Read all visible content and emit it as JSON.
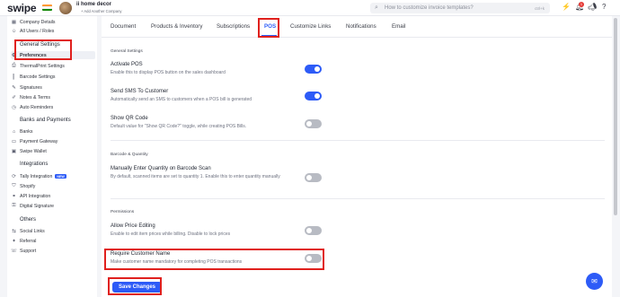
{
  "app": {
    "logo_text": "swipe",
    "company_name": "ii home decor",
    "add_company": "+ Add Another Company",
    "search_placeholder": "How to customize invoice templates?",
    "search_shortcut": "ctrl+k",
    "notification_count": "1",
    "flag_colors": [
      "#ff9933",
      "#ffffff",
      "#138808"
    ]
  },
  "sidebar": {
    "top_items": [
      {
        "label": "Company Details",
        "icon": "building-icon"
      },
      {
        "label": "All Users / Roles",
        "icon": "users-icon"
      }
    ],
    "groups": [
      {
        "heading": "General Settings",
        "items": [
          {
            "label": "Preferences",
            "icon": "gear-icon",
            "active": true
          },
          {
            "label": "ThermalPrint Settings",
            "icon": "printer-icon"
          },
          {
            "label": "Barcode Settings",
            "icon": "barcode-icon"
          },
          {
            "label": "Signatures",
            "icon": "signature-icon"
          },
          {
            "label": "Notes & Terms",
            "icon": "notes-icon"
          },
          {
            "label": "Auto Reminders",
            "icon": "clock-icon"
          }
        ]
      },
      {
        "heading": "Banks and Payments",
        "items": [
          {
            "label": "Banks",
            "icon": "bank-icon"
          },
          {
            "label": "Payment Gateway",
            "icon": "card-icon"
          },
          {
            "label": "Swipe Wallet",
            "icon": "wallet-icon"
          }
        ]
      },
      {
        "heading": "Integrations",
        "items": [
          {
            "label": "Tally Integration",
            "icon": "sync-icon",
            "tag": "NEW"
          },
          {
            "label": "Shopify",
            "icon": "shopify-icon"
          },
          {
            "label": "API Integration",
            "icon": "api-icon"
          },
          {
            "label": "Digital Signature",
            "icon": "key-icon"
          }
        ]
      },
      {
        "heading": "Others",
        "items": [
          {
            "label": "Social Links",
            "icon": "share-icon"
          },
          {
            "label": "Referral",
            "icon": "gift-icon"
          },
          {
            "label": "Support",
            "icon": "support-icon"
          }
        ]
      }
    ]
  },
  "tabs": [
    {
      "label": "Document"
    },
    {
      "label": "Products & Inventory"
    },
    {
      "label": "Subscriptions"
    },
    {
      "label": "POS",
      "active": true
    },
    {
      "label": "Customize Links"
    },
    {
      "label": "Notifications"
    },
    {
      "label": "Email"
    }
  ],
  "sections": {
    "general": "General Settings",
    "barcode": "Barcode & Quantity",
    "permissions": "Permissions"
  },
  "settings": [
    {
      "title": "Activate POS",
      "desc": "Enable this to display POS button on the sales dashboard",
      "on": true
    },
    {
      "title": "Send SMS To Customer",
      "desc": "Automatically send an SMS to customers when a POS bill is generated",
      "on": true
    },
    {
      "title": "Show QR Code",
      "desc": "Default value for \"Show QR Code?\" toggle, while creating POS Bills.",
      "on": false
    },
    {
      "title": "Manually Enter Quantity on Barcode Scan",
      "desc": "By default, scanned items are set to quantity 1. Enable this to enter quantity manually",
      "on": false
    },
    {
      "title": "Allow Price Editing",
      "desc": "Enable to edit item prices while billing. Disable to lock prices",
      "on": false
    },
    {
      "title": "Require Customer Name",
      "desc": "Make customer name mandatory for completing POS transactions",
      "on": false
    }
  ],
  "save_label": "Save Changes",
  "colors": {
    "accent": "#2d5bf7",
    "highlight": "#e0201d",
    "toggle_off": "#b8bbc3"
  }
}
